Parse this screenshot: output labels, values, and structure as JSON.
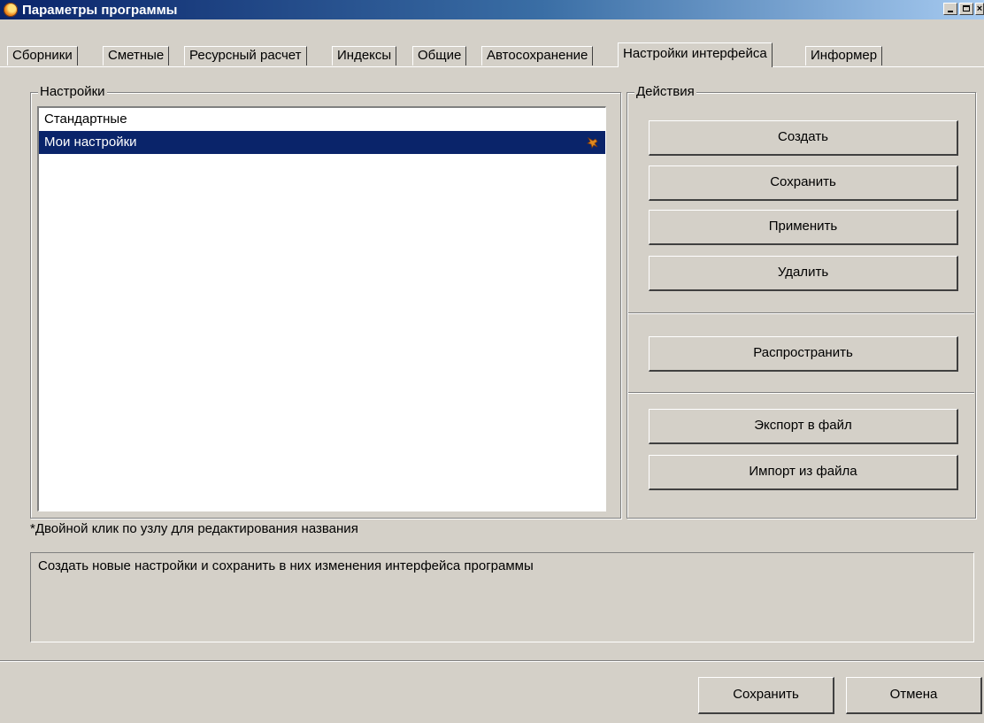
{
  "window": {
    "title": "Параметры программы",
    "icon": "app-logo-icon"
  },
  "tabs": [
    {
      "label": "Сборники"
    },
    {
      "label": "Сметные"
    },
    {
      "label": "Ресурсный расчет"
    },
    {
      "label": "Индексы"
    },
    {
      "label": "Общие"
    },
    {
      "label": "Автосохранение"
    },
    {
      "label": "Настройки интерфейса",
      "active": true
    },
    {
      "label": "Информер"
    }
  ],
  "settings_group": {
    "legend": "Настройки",
    "items": [
      {
        "label": "Стандартные"
      },
      {
        "label": "Мои настройки",
        "selected": true,
        "icon": "pin-icon"
      }
    ]
  },
  "actions_group": {
    "legend": "Действия",
    "create_label": "Создать",
    "save_label": "Сохранить",
    "apply_label": "Применить",
    "delete_label": "Удалить",
    "distribute_label": "Распространить",
    "export_label": "Экспорт в файл",
    "import_label": "Импорт из файла"
  },
  "hint": "*Двойной клик по узлу для редактирования названия",
  "description": "Создать новые настройки и сохранить в них изменения интерфейса программы",
  "footer": {
    "save_label": "Сохранить",
    "cancel_label": "Отмена"
  },
  "colors": {
    "title_bar": "#0a246a",
    "selection": "#0a246a",
    "face": "#d4d0c8"
  }
}
